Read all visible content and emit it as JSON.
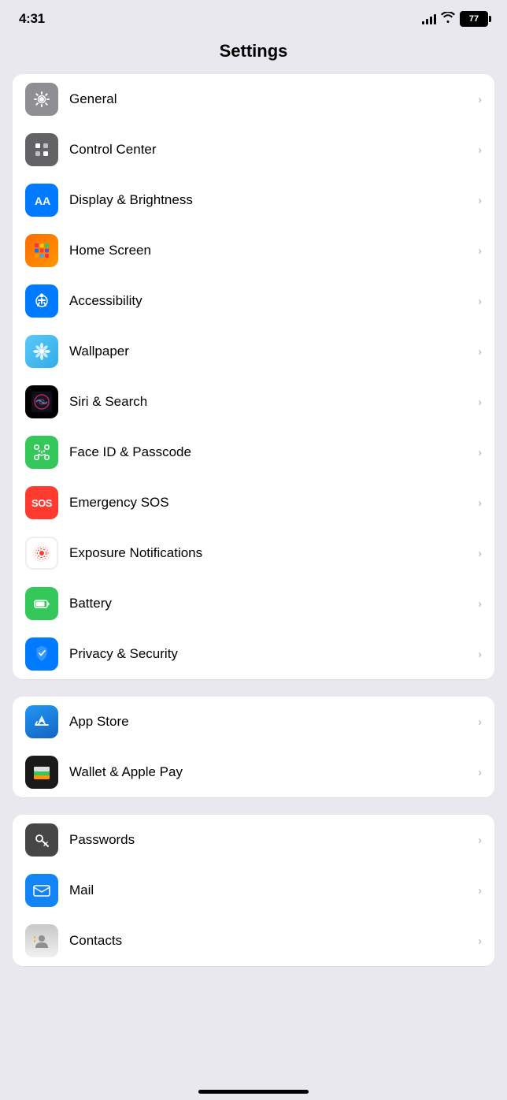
{
  "statusBar": {
    "time": "4:31",
    "battery": "77"
  },
  "page": {
    "title": "Settings"
  },
  "groups": [
    {
      "id": "group1",
      "items": [
        {
          "id": "general",
          "label": "General",
          "iconType": "gear",
          "iconBg": "gray"
        },
        {
          "id": "control-center",
          "label": "Control Center",
          "iconType": "toggle",
          "iconBg": "dark-gray"
        },
        {
          "id": "display-brightness",
          "label": "Display & Brightness",
          "iconType": "aa",
          "iconBg": "blue"
        },
        {
          "id": "home-screen",
          "label": "Home Screen",
          "iconType": "grid",
          "iconBg": "orange"
        },
        {
          "id": "accessibility",
          "label": "Accessibility",
          "iconType": "person-circle",
          "iconBg": "blue"
        },
        {
          "id": "wallpaper",
          "label": "Wallpaper",
          "iconType": "flower",
          "iconBg": "teal"
        },
        {
          "id": "siri-search",
          "label": "Siri & Search",
          "iconType": "siri",
          "iconBg": "dark"
        },
        {
          "id": "face-id",
          "label": "Face ID & Passcode",
          "iconType": "faceid",
          "iconBg": "green"
        },
        {
          "id": "emergency-sos",
          "label": "Emergency SOS",
          "iconType": "sos",
          "iconBg": "red"
        },
        {
          "id": "exposure",
          "label": "Exposure Notifications",
          "iconType": "exposure",
          "iconBg": "white"
        },
        {
          "id": "battery",
          "label": "Battery",
          "iconType": "battery",
          "iconBg": "green"
        },
        {
          "id": "privacy",
          "label": "Privacy & Security",
          "iconType": "hand",
          "iconBg": "blue"
        }
      ]
    },
    {
      "id": "group2",
      "items": [
        {
          "id": "app-store",
          "label": "App Store",
          "iconType": "appstore",
          "iconBg": "app-store"
        },
        {
          "id": "wallet",
          "label": "Wallet & Apple Pay",
          "iconType": "wallet",
          "iconBg": "black"
        }
      ]
    },
    {
      "id": "group3",
      "items": [
        {
          "id": "passwords",
          "label": "Passwords",
          "iconType": "key",
          "iconBg": "dark"
        },
        {
          "id": "mail",
          "label": "Mail",
          "iconType": "mail",
          "iconBg": "blue"
        },
        {
          "id": "contacts",
          "label": "Contacts",
          "iconType": "contacts",
          "iconBg": "gradient"
        }
      ]
    }
  ]
}
